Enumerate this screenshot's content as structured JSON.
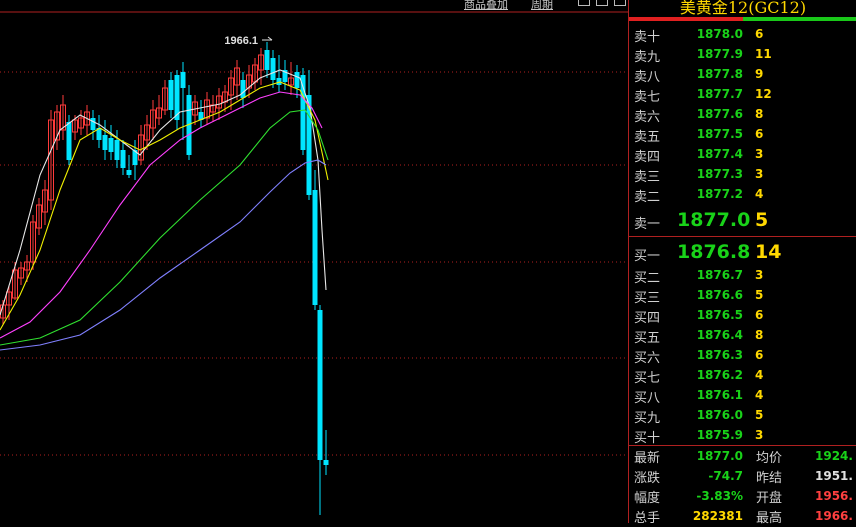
{
  "toolbar": {
    "overlay_label": "商品叠加",
    "period_label": "周期"
  },
  "instrument": {
    "title": "美黄金12(GC12)"
  },
  "chart_data": {
    "type": "candlestick",
    "high_label": "1966.1"
  },
  "colors": {
    "up": "#ff3b3b",
    "down": "#00e5ff",
    "ma1": "#e8e8e8",
    "ma2": "#f0f000",
    "ma3": "#ff40ff",
    "ma4": "#30e030",
    "ma5": "#8080ff"
  },
  "asks": [
    {
      "label": "卖十",
      "price": "1878.0",
      "qty": "6"
    },
    {
      "label": "卖九",
      "price": "1877.9",
      "qty": "11"
    },
    {
      "label": "卖八",
      "price": "1877.8",
      "qty": "9"
    },
    {
      "label": "卖七",
      "price": "1877.7",
      "qty": "12"
    },
    {
      "label": "卖六",
      "price": "1877.6",
      "qty": "8"
    },
    {
      "label": "卖五",
      "price": "1877.5",
      "qty": "6"
    },
    {
      "label": "卖四",
      "price": "1877.4",
      "qty": "3"
    },
    {
      "label": "卖三",
      "price": "1877.3",
      "qty": "3"
    },
    {
      "label": "卖二",
      "price": "1877.2",
      "qty": "4"
    },
    {
      "label": "卖一",
      "price": "1877.0",
      "qty": "5"
    }
  ],
  "bids": [
    {
      "label": "买一",
      "price": "1876.8",
      "qty": "14"
    },
    {
      "label": "买二",
      "price": "1876.7",
      "qty": "3"
    },
    {
      "label": "买三",
      "price": "1876.6",
      "qty": "5"
    },
    {
      "label": "买四",
      "price": "1876.5",
      "qty": "6"
    },
    {
      "label": "买五",
      "price": "1876.4",
      "qty": "8"
    },
    {
      "label": "买六",
      "price": "1876.3",
      "qty": "6"
    },
    {
      "label": "买七",
      "price": "1876.2",
      "qty": "4"
    },
    {
      "label": "买八",
      "price": "1876.1",
      "qty": "4"
    },
    {
      "label": "买九",
      "price": "1876.0",
      "qty": "5"
    },
    {
      "label": "买十",
      "price": "1875.9",
      "qty": "3"
    }
  ],
  "stats": {
    "latest_label": "最新",
    "latest": "1877.0",
    "avg_label": "均价",
    "avg": "1924.",
    "change_label": "涨跌",
    "change": "-74.7",
    "prev_label": "昨结",
    "prev": "1951.",
    "pct_label": "幅度",
    "pct": "-3.83%",
    "open_label": "开盘",
    "open": "1956.",
    "volume_label": "总手",
    "volume": "282381",
    "high_label": "最高",
    "high": "1966."
  }
}
